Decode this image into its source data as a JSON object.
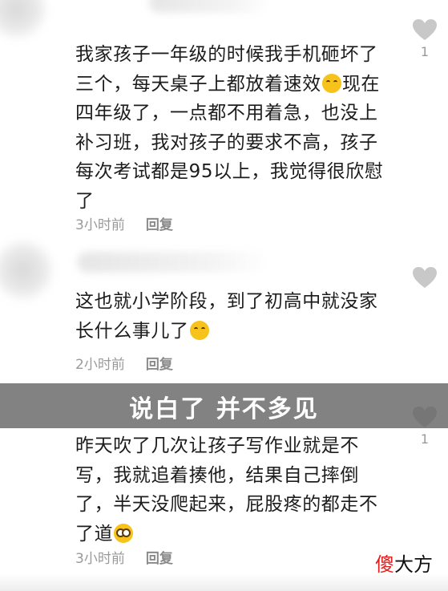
{
  "comments": [
    {
      "lines": [
        "我家孩子一年级的时候我手机砸坏了",
        "三个，每天桌子上都放着速效",
        "四年级了，一点都不用着急，也没上",
        "补习班，我对孩子的要求不高，孩子",
        "每次考试都是95以上，我觉得很欣慰",
        "了"
      ],
      "emoji_after_line_2": "laughing-crying-emoji",
      "line_2_tail": "现在",
      "time": "3小时前",
      "reply_label": "回复",
      "like_count": "1"
    },
    {
      "lines": [
        "这也就小学阶段，到了初高中就没家",
        "长什么事儿了"
      ],
      "emoji": "laughing-crying-emoji",
      "time": "2小时前",
      "reply_label": "回复",
      "like_count": ""
    },
    {
      "lines": [
        "昨天吹了几次让孩子写作业就是不",
        "写，我就追着揍他，结果自己摔倒",
        "了，半天没爬起来，屁股疼的都走不",
        "了道"
      ],
      "emoji": "dizzy-emoji",
      "time": "3小时前",
      "reply_label": "回复",
      "like_count": "1"
    }
  ],
  "banner": {
    "text": "说白了 并不多见"
  },
  "watermark": {
    "accent": "傻",
    "rest": "大方"
  },
  "colors": {
    "text": "#1c1c1c",
    "meta": "#9a9a9a",
    "like_icon": "#c8c8c8",
    "banner_bg": "#5f5f5f",
    "watermark_accent": "#e02020"
  }
}
